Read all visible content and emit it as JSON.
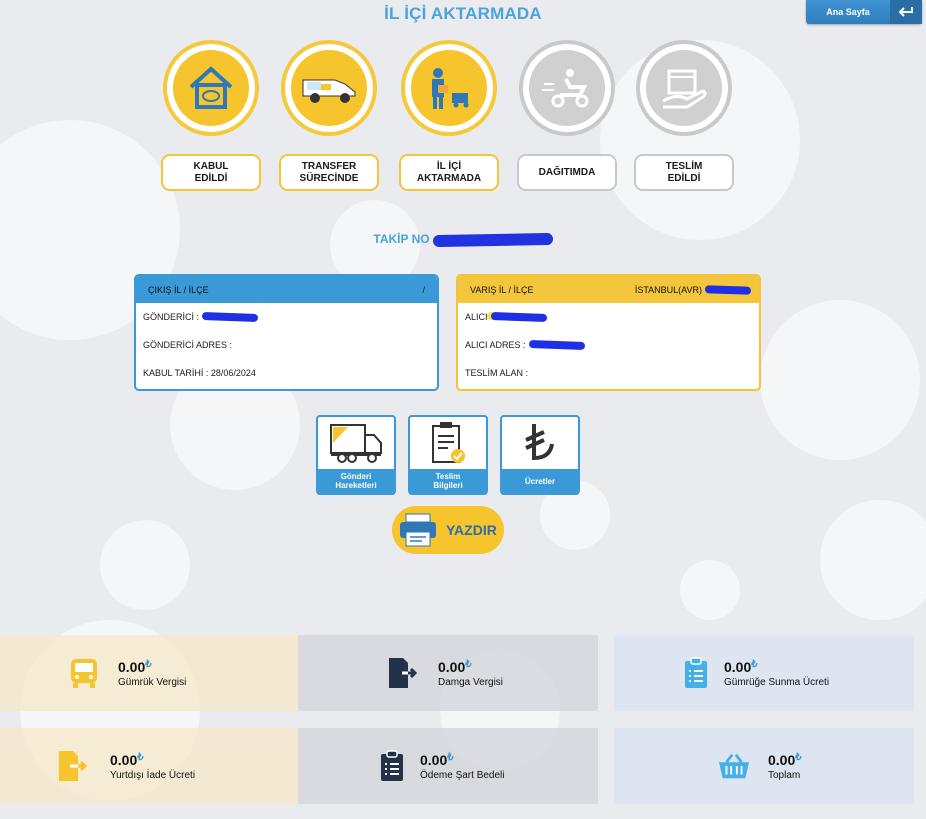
{
  "page": {
    "title": "İL İÇİ AKTARMADA"
  },
  "header": {
    "home_label": "Ana Sayfa"
  },
  "steps": [
    {
      "label": "KABUL\nEDİLDİ",
      "state": "done",
      "icon": "house-icon"
    },
    {
      "label": "TRANSFER\nSÜRECİNDE",
      "state": "done",
      "icon": "van-icon"
    },
    {
      "label": "İL İÇİ\nAKTARMADA",
      "state": "done",
      "icon": "courier-icon"
    },
    {
      "label": "DAĞITIMDA",
      "state": "pending",
      "icon": "scooter-icon"
    },
    {
      "label": "TESLİM\nEDİLDİ",
      "state": "pending",
      "icon": "hand-box-icon"
    }
  ],
  "tracking": {
    "label": "TAKİP NO"
  },
  "sender_card": {
    "header_label": "ÇIKIŞ İL / İLÇE",
    "header_value": "/",
    "sender_label": "GÖNDERİCİ :",
    "address_label": "GÖNDERİCİ ADRES :",
    "date_label": "KABUL TARİHİ :",
    "date_value": "28/06/2024"
  },
  "receiver_card": {
    "header_label": "VARIŞ İL / İLÇE",
    "header_value": "İSTANBUL(AVR)",
    "receiver_label": "ALICI",
    "address_label": "ALICI ADRES :",
    "delivered_label": "TESLİM ALAN :"
  },
  "actions": [
    {
      "label": "Gönderi\nHareketleri",
      "icon": "truck-icon"
    },
    {
      "label": "Teslim\nBilgileri",
      "icon": "clipboard-check-icon"
    },
    {
      "label": "Ücretler",
      "icon": "lira-icon"
    }
  ],
  "print": {
    "label": "YAZDIR"
  },
  "fees": [
    {
      "amount": "0.00",
      "currency": "₺",
      "name": "Gümrük Vergisi",
      "icon": "bus-icon"
    },
    {
      "amount": "0.00",
      "currency": "₺",
      "name": "Damga Vergisi",
      "icon": "file-export-icon"
    },
    {
      "amount": "0.00",
      "currency": "₺",
      "name": "Gümrüğe Sunma Ücreti",
      "icon": "clipboard-list-icon"
    },
    {
      "amount": "0.00",
      "currency": "₺",
      "name": "Yurtdışı İade Ücreti",
      "icon": "file-export-icon"
    },
    {
      "amount": "0.00",
      "currency": "₺",
      "name": "Ödeme Şart Bedeli",
      "icon": "clipboard-list-icon"
    },
    {
      "amount": "0.00",
      "currency": "₺",
      "name": "Toplam",
      "icon": "basket-icon"
    }
  ],
  "colors": {
    "accent_blue": "#3a9ad8",
    "accent_yellow": "#f6c42c",
    "pending_gray": "#d0d0d0"
  }
}
